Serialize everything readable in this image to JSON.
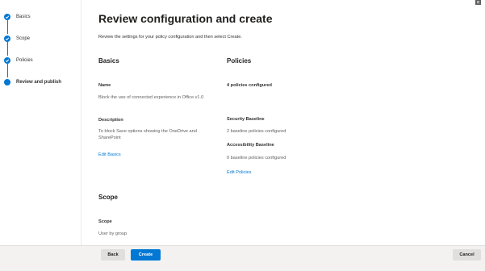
{
  "wizard": {
    "steps": [
      {
        "label": "Basics",
        "state": "done"
      },
      {
        "label": "Scope",
        "state": "done"
      },
      {
        "label": "Policies",
        "state": "done"
      },
      {
        "label": "Review and publish",
        "state": "current"
      }
    ]
  },
  "page": {
    "title": "Review configuration and create",
    "intro": "Review the settings for your policy configuration and then select Create."
  },
  "basics": {
    "heading": "Basics",
    "name_label": "Name",
    "name_value": "Block the use of connected experience in Office v1.0",
    "description_label": "Description",
    "description_value": "To block Save options showing the OneDrive and SharePoint",
    "edit_link": "Edit Basics"
  },
  "policies": {
    "heading": "Policies",
    "summary": "4 policies configured",
    "security_label": "Security Baseline",
    "security_value": "2 baseline policies configured",
    "accessibility_label": "Accessibility Baseline",
    "accessibility_value": "0 baseline policies configured",
    "edit_link": "Edit Policies"
  },
  "scope": {
    "heading": "Scope",
    "label": "Scope",
    "value": "User by group"
  },
  "footer": {
    "back_label": "Back",
    "create_label": "Create",
    "cancel_label": "Cancel"
  },
  "corner_glyph": "⊟",
  "colors": {
    "accent": "#0078d4",
    "footer_bg": "#f3f2f1"
  }
}
